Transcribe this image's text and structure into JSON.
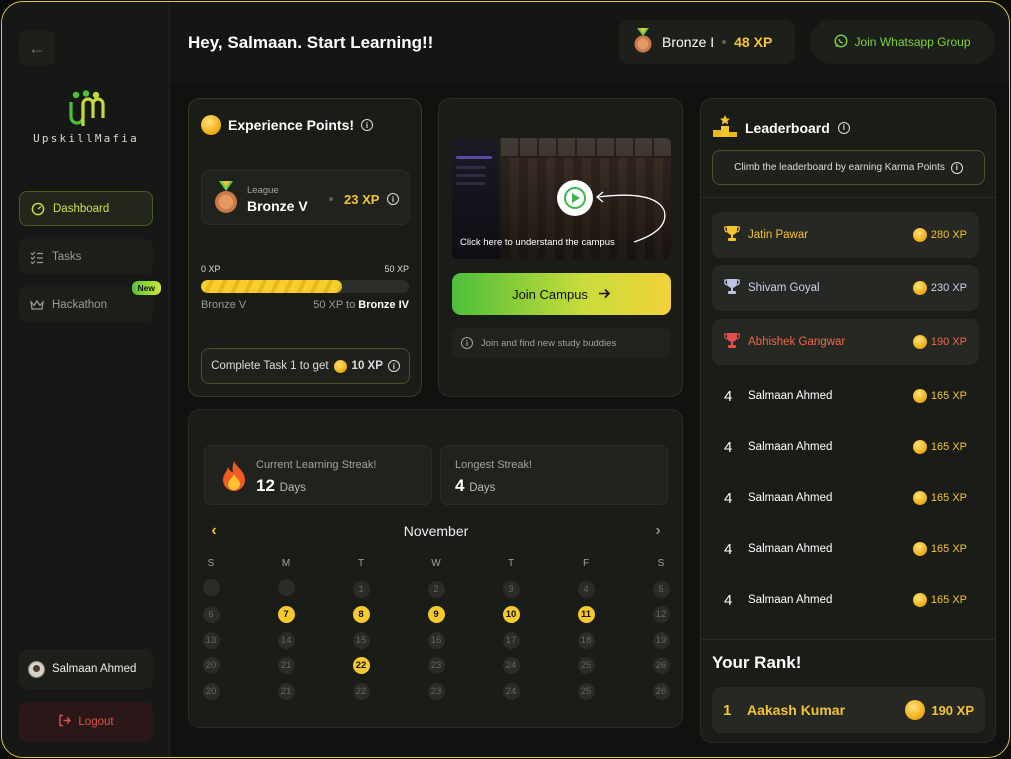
{
  "sidebar": {
    "brand": "UpskillMafia",
    "nav": [
      {
        "label": "Dashboard",
        "active": true
      },
      {
        "label": "Tasks",
        "active": false
      },
      {
        "label": "Hackathon",
        "active": false,
        "badge": "New"
      }
    ],
    "profile_name": "Salmaan Ahmed",
    "logout_label": "Logout"
  },
  "header": {
    "greeting": "Hey, Salmaan. Start Learning!!",
    "league": "Bronze I",
    "xp": "48 XP",
    "whatsapp_label": "Join Whatsapp Group"
  },
  "xp_card": {
    "title": "Experience Points!",
    "league_caption": "League",
    "league_name": "Bronze V",
    "league_xp": "23 XP",
    "progress_start": "0 XP",
    "progress_end": "50 XP",
    "progress_fraction": 0.68,
    "current_level": "Bronze V",
    "next_prefix": "50 XP to",
    "next_level": "Bronze IV",
    "task_cta": "Complete Task 1 to get",
    "task_reward": "10 XP"
  },
  "campus": {
    "video_caption": "Click here to understand the campus",
    "join_label": "Join Campus",
    "buddies_text": "Join and find new study buddies"
  },
  "streak": {
    "current_label": "Current Learning Streak!",
    "current_value": "12",
    "current_unit": "Days",
    "longest_label": "Longest Streak!",
    "longest_value": "4",
    "longest_unit": "Days",
    "month": "November",
    "weekdays": [
      "S",
      "M",
      "T",
      "W",
      "T",
      "F",
      "S"
    ],
    "weeks": [
      [
        "",
        "",
        "1",
        "2",
        "3",
        "4",
        "5"
      ],
      [
        "6",
        "7",
        "8",
        "9",
        "10",
        "11",
        "12"
      ],
      [
        "13",
        "14",
        "15",
        "16",
        "17",
        "18",
        "19"
      ],
      [
        "20",
        "21",
        "22",
        "23",
        "24",
        "25",
        "26"
      ],
      [
        "20",
        "21",
        "22",
        "23",
        "24",
        "25",
        "26"
      ]
    ],
    "highlighted": [
      "7",
      "8",
      "9",
      "10",
      "11",
      "22"
    ]
  },
  "leaderboard": {
    "title": "Leaderboard",
    "climb_text": "Climb the leaderboard by earning Karma Points",
    "rows": [
      {
        "rank": "trophy-gold",
        "name": "Jatin Pawar",
        "xp": "280 XP",
        "color": "#f4c431"
      },
      {
        "rank": "trophy-silver",
        "name": "Shivam Goyal",
        "xp": "230 XP",
        "color": "#c9d3f2"
      },
      {
        "rank": "trophy-bronze",
        "name": "Abhishek Gangwar",
        "xp": "190 XP",
        "color": "#f0684a"
      },
      {
        "rank": "4",
        "name": "Salmaan Ahmed",
        "xp": "165 XP",
        "color": "#ffffff"
      },
      {
        "rank": "4",
        "name": "Salmaan Ahmed",
        "xp": "165 XP",
        "color": "#ffffff"
      },
      {
        "rank": "4",
        "name": "Salmaan Ahmed",
        "xp": "165 XP",
        "color": "#ffffff"
      },
      {
        "rank": "4",
        "name": "Salmaan Ahmed",
        "xp": "165 XP",
        "color": "#ffffff"
      },
      {
        "rank": "4",
        "name": "Salmaan Ahmed",
        "xp": "165 XP",
        "color": "#ffffff"
      }
    ],
    "your_rank_label": "Your Rank!",
    "my_rank": "1",
    "my_name": "Aakash Kumar",
    "my_xp": "190 XP"
  },
  "colors": {
    "accent": "#f4c431",
    "green": "#7ed13c",
    "danger": "#e0514a"
  }
}
